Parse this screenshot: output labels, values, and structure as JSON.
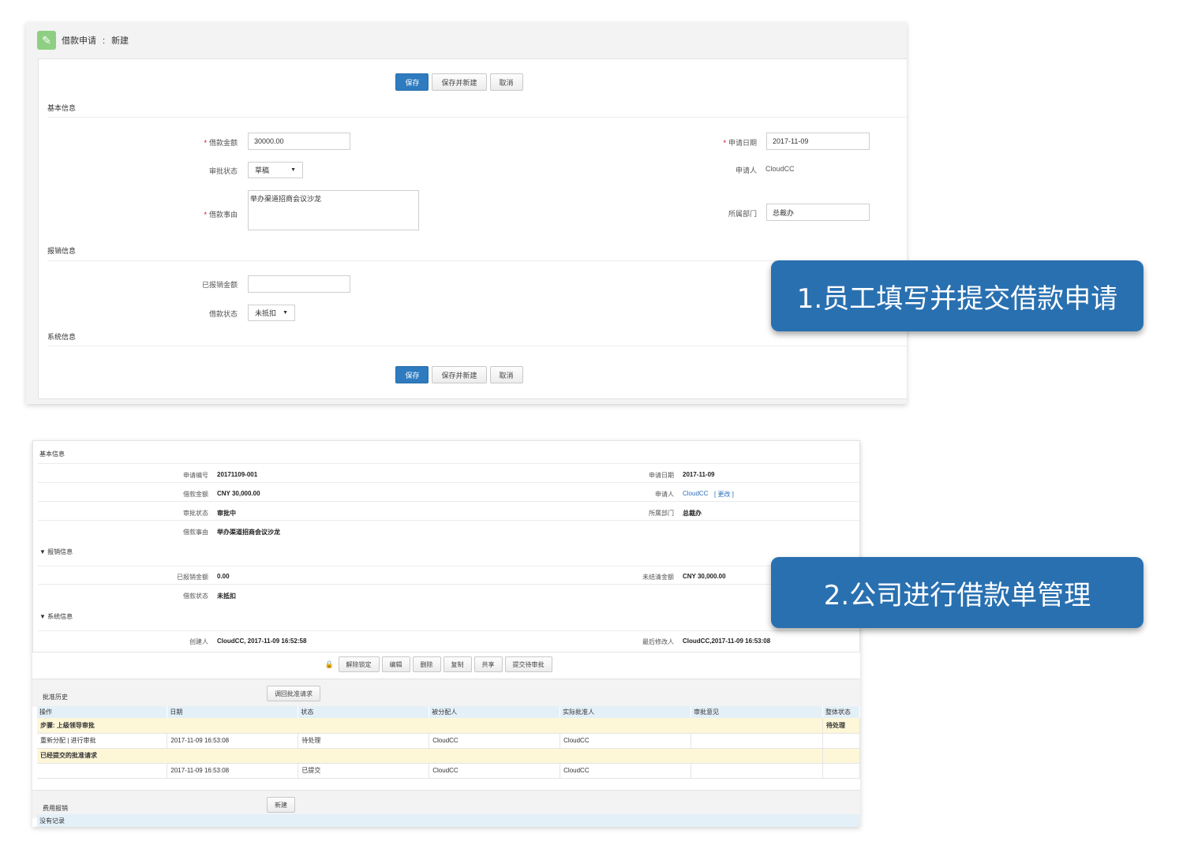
{
  "form_new": {
    "title": "借款申请",
    "title_sep": ":",
    "mode": "新建",
    "buttons": {
      "save": "保存",
      "save_new": "保存并新建",
      "cancel": "取消"
    },
    "sections": {
      "basic": "基本信息",
      "reimburse": "报销信息",
      "system": "系统信息"
    },
    "fields": {
      "amount_label": "借款金额",
      "amount_value": "30000.00",
      "approval_status_label": "审批状态",
      "approval_status_value": "草稿",
      "reason_label": "借款事由",
      "reason_value": "举办渠道招商会议沙龙",
      "apply_date_label": "申请日期",
      "apply_date_value": "2017-11-09",
      "applicant_label": "申请人",
      "applicant_value": "CloudCC",
      "department_label": "所属部门",
      "department_value": "总裁办",
      "reimbursed_label": "已报销金额",
      "reimbursed_value": "",
      "loan_status_label": "借款状态",
      "loan_status_value": "未抵扣"
    }
  },
  "callouts": {
    "step1": "1.员工填写并提交借款申请",
    "step2": "2.公司进行借款单管理"
  },
  "detail": {
    "sections": {
      "basic": "基本信息",
      "reimburse": "报销信息",
      "system": "系统信息"
    },
    "toggle_glyph": "▼",
    "rows": {
      "app_no_label": "申请编号",
      "app_no_value": "20171109-001",
      "apply_date_label": "申请日期",
      "apply_date_value": "2017-11-09",
      "amount_label": "借款金额",
      "amount_value": "CNY 30,000.00",
      "applicant_label": "申请人",
      "applicant_value": "CloudCC",
      "applicant_change": "[ 更改 ]",
      "approval_status_label": "审批状态",
      "approval_status_value": "审批中",
      "department_label": "所属部门",
      "department_value": "总裁办",
      "reason_label": "借款事由",
      "reason_value": "举办渠道招商会议沙龙",
      "reimbursed_label": "已报销金额",
      "reimbursed_value": "0.00",
      "unsettled_label": "未结清金额",
      "unsettled_value": "CNY 30,000.00",
      "loan_status_label": "借款状态",
      "loan_status_value": "未抵扣",
      "creator_label": "创建人",
      "creator_value": "CloudCC, 2017-11-09 16:52:58",
      "modifier_label": "最后修改人",
      "modifier_value": "CloudCC,2017-11-09 16:53:08"
    },
    "actions": [
      "解除锁定",
      "编辑",
      "删除",
      "复制",
      "共享",
      "提交待审批"
    ],
    "approval_history": {
      "title": "批准历史",
      "recall_button": "调回批准请求",
      "columns": [
        "操作",
        "日期",
        "状态",
        "被分配人",
        "实际批准人",
        "审批意见",
        "整体状态"
      ],
      "step_row": {
        "label": "步骤: 上级领导审批",
        "overall": "待处理"
      },
      "row1": {
        "op": "重新分配 | 进行审批",
        "date": "2017-11-09 16:53:08",
        "status": "待处理",
        "assignee": "CloudCC",
        "approver": "CloudCC",
        "comment": ""
      },
      "submitted_row": {
        "label": "已经提交的批准请求"
      },
      "row2": {
        "op": "",
        "date": "2017-11-09 16:53:08",
        "status": "已提交",
        "assignee": "CloudCC",
        "approver": "CloudCC",
        "comment": ""
      }
    },
    "expense": {
      "title": "费用报销",
      "new_button": "新建",
      "empty_text": "没有记录"
    }
  }
}
